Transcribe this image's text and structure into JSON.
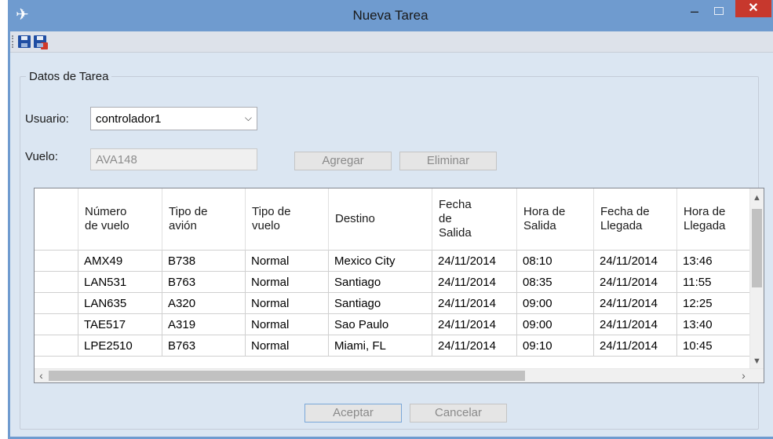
{
  "window": {
    "title": "Nueva Tarea",
    "app_icon": "airplane-icon",
    "controls": {
      "minimize": "–",
      "close": "✕"
    }
  },
  "toolbar": {
    "icons": [
      "save-icon",
      "save-close-icon"
    ]
  },
  "group": {
    "label": "Datos de Tarea"
  },
  "form": {
    "usuario_label": "Usuario:",
    "usuario_value": "controlador1",
    "vuelo_label": "Vuelo:",
    "vuelo_value": "AVA148",
    "agregar_label": "Agregar",
    "eliminar_label": "Eliminar"
  },
  "table": {
    "columns": [
      "Número\nde vuelo",
      "Tipo de\navión",
      "Tipo de\nvuelo",
      "Destino",
      "Fecha\nde\nSalida",
      "Hora de\nSalida",
      "Fecha de\nLlegada",
      "Hora de\nLlegada"
    ],
    "rows": [
      [
        "AMX49",
        "B738",
        "Normal",
        "Mexico City",
        "24/11/2014",
        "08:10",
        "24/11/2014",
        "13:46"
      ],
      [
        "LAN531",
        "B763",
        "Normal",
        "Santiago",
        "24/11/2014",
        "08:35",
        "24/11/2014",
        "11:55"
      ],
      [
        "LAN635",
        "A320",
        "Normal",
        "Santiago",
        "24/11/2014",
        "09:00",
        "24/11/2014",
        "12:25"
      ],
      [
        "TAE517",
        "A319",
        "Normal",
        "Sao Paulo",
        "24/11/2014",
        "09:00",
        "24/11/2014",
        "13:40"
      ],
      [
        "LPE2510",
        "B763",
        "Normal",
        "Miami, FL",
        "24/11/2014",
        "09:10",
        "24/11/2014",
        "10:45"
      ]
    ]
  },
  "footer": {
    "aceptar_label": "Aceptar",
    "cancelar_label": "Cancelar"
  }
}
